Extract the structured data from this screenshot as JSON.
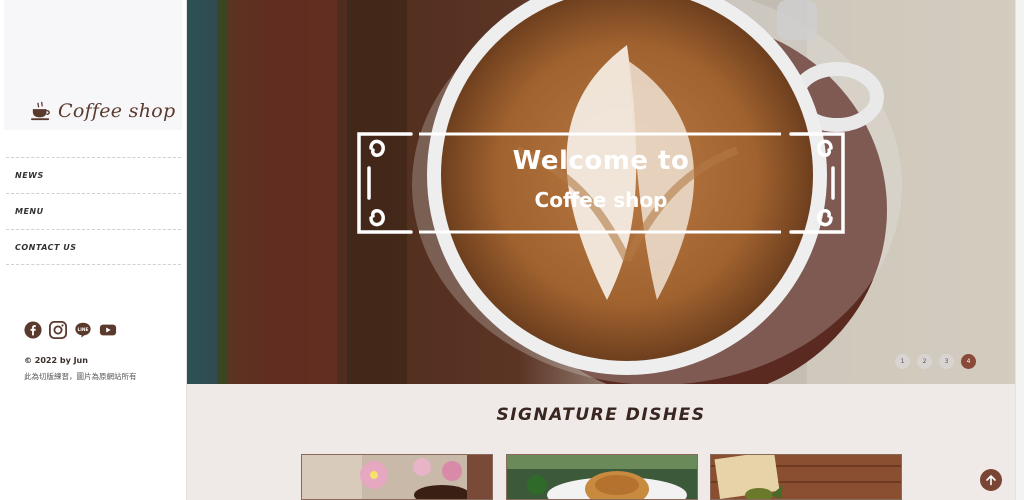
{
  "brand": {
    "name": "Coffee shop"
  },
  "nav": {
    "items": [
      {
        "label": "NEWS"
      },
      {
        "label": "MENU"
      },
      {
        "label": "CONTACT US"
      }
    ]
  },
  "socials": [
    {
      "icon": "facebook-icon"
    },
    {
      "icon": "instagram-icon"
    },
    {
      "icon": "line-icon",
      "label": "LINE"
    },
    {
      "icon": "youtube-icon"
    }
  ],
  "footer": {
    "copyright": "© 2022 by Jun",
    "note": "此為切版練習，圖片為原網站所有"
  },
  "hero": {
    "title_line1": "Welcome to",
    "title_line2": "Coffee shop"
  },
  "carousel": {
    "dots": [
      "1",
      "2",
      "3",
      "4"
    ],
    "active": "4"
  },
  "section": {
    "title": "SIGNATURE DISHES"
  },
  "colors": {
    "accent": "#7a4535",
    "brand_text": "#5b3a2e"
  }
}
